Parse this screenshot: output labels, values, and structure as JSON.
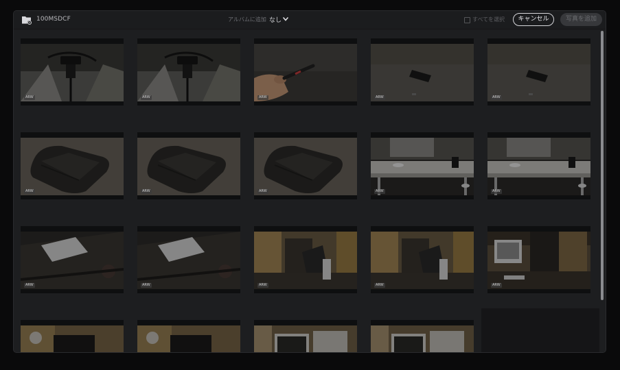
{
  "header": {
    "folder_icon": "folder-icon",
    "folder_name": "100MSDCF",
    "album_label": "アルバムに追加",
    "album_value": "なし",
    "select_all_label": "すべてを選択",
    "cancel_label": "キャンセル",
    "add_photos_label": "写真を追加"
  },
  "photos": [
    {
      "scene": "cable-clip",
      "badge": "ARW"
    },
    {
      "scene": "cable-clip",
      "badge": "ARW"
    },
    {
      "scene": "hand-usb",
      "badge": "ARW"
    },
    {
      "scene": "usb-floor",
      "badge": "ARW"
    },
    {
      "scene": "usb-floor",
      "badge": "ARW"
    },
    {
      "scene": "tray",
      "badge": "ARW"
    },
    {
      "scene": "tray",
      "badge": "ARW"
    },
    {
      "scene": "tray",
      "badge": "ARW"
    },
    {
      "scene": "desk-shelf",
      "badge": "ARW"
    },
    {
      "scene": "desk-shelf",
      "badge": "ARW"
    },
    {
      "scene": "keyboard",
      "badge": "ARW"
    },
    {
      "scene": "keyboard",
      "badge": "ARW"
    },
    {
      "scene": "room-chair",
      "badge": "ARW"
    },
    {
      "scene": "room-chair",
      "badge": "ARW"
    },
    {
      "scene": "imac-room",
      "badge": "ARW"
    },
    {
      "scene": "room-lamp",
      "badge": ""
    },
    {
      "scene": "room-lamp",
      "badge": ""
    },
    {
      "scene": "room-monitor",
      "badge": ""
    },
    {
      "scene": "room-monitor",
      "badge": ""
    }
  ],
  "colors": {
    "window_bg": "#1d1e20",
    "scrollbar": "#8a8b8f",
    "cancel_border": "#d7d7db"
  }
}
